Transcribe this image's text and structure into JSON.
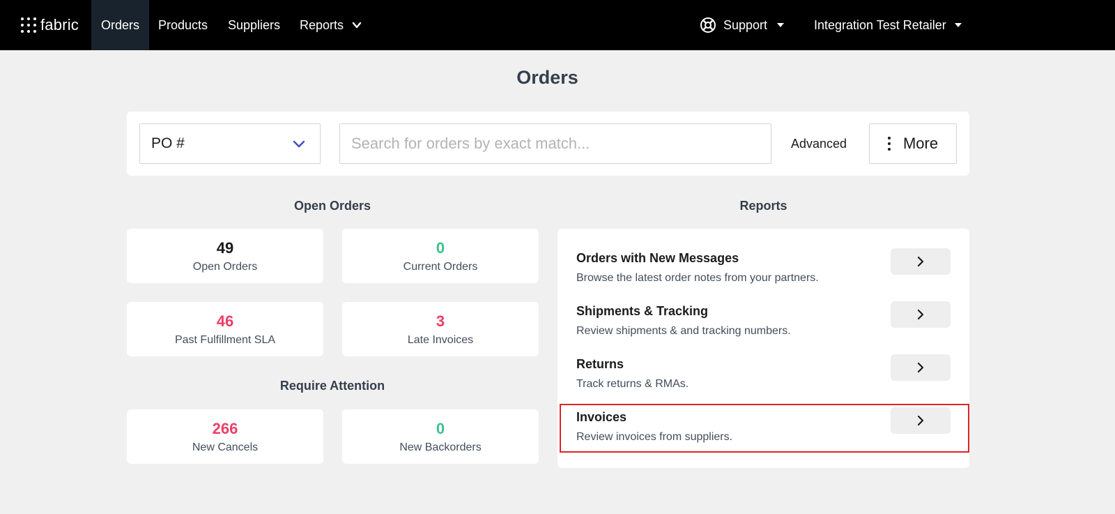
{
  "nav": {
    "logo": "fabric",
    "items": [
      {
        "label": "Orders"
      },
      {
        "label": "Products"
      },
      {
        "label": "Suppliers"
      },
      {
        "label": "Reports"
      }
    ],
    "support": "Support",
    "account": "Integration Test Retailer"
  },
  "page": {
    "title": "Orders"
  },
  "search": {
    "field_select": "PO #",
    "placeholder": "Search for orders by exact match...",
    "advanced": "Advanced",
    "more": "More"
  },
  "open_orders": {
    "heading": "Open Orders",
    "stats": [
      {
        "value": "49",
        "label": "Open Orders",
        "color": "#1b1b1b"
      },
      {
        "value": "0",
        "label": "Current Orders",
        "color": "#3ec18d"
      },
      {
        "value": "46",
        "label": "Past Fulfillment SLA",
        "color": "#ec3f66"
      },
      {
        "value": "3",
        "label": "Late Invoices",
        "color": "#ec3f66"
      }
    ]
  },
  "require_attention": {
    "heading": "Require Attention",
    "stats": [
      {
        "value": "266",
        "label": "New Cancels",
        "color": "#ec3f66"
      },
      {
        "value": "0",
        "label": "New Backorders",
        "color": "#3ec18d"
      }
    ]
  },
  "reports": {
    "heading": "Reports",
    "items": [
      {
        "title": "Orders with New Messages",
        "description": "Browse the latest order notes from your partners."
      },
      {
        "title": "Shipments & Tracking",
        "description": "Review shipments & and tracking numbers."
      },
      {
        "title": "Returns",
        "description": "Track returns & RMAs."
      },
      {
        "title": "Invoices",
        "description": "Review invoices from suppliers."
      }
    ]
  }
}
